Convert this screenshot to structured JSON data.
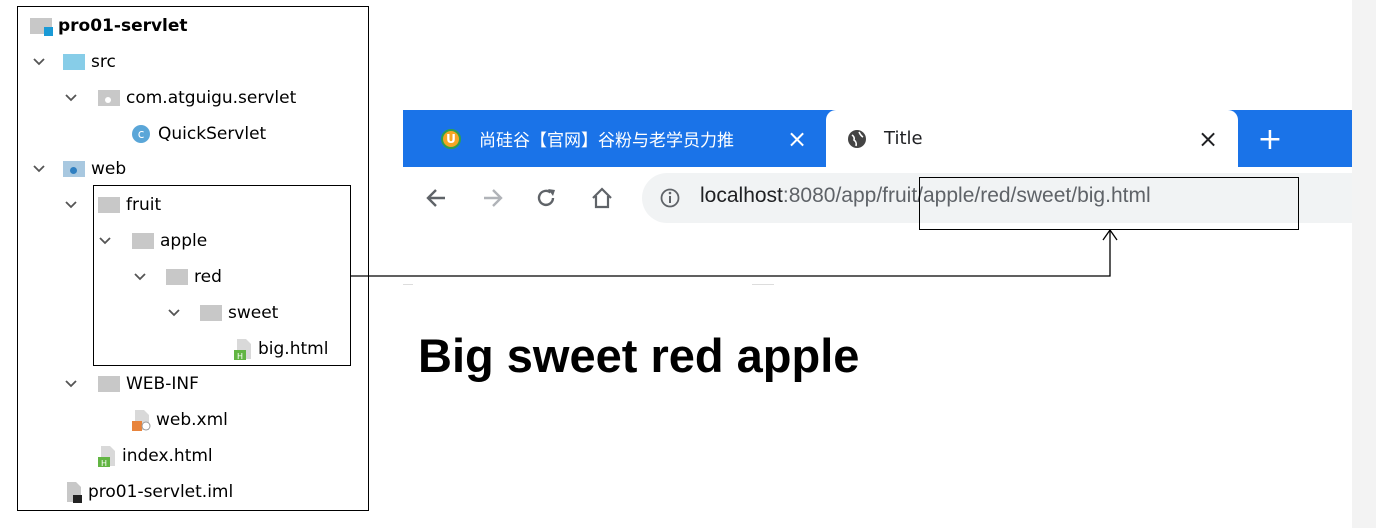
{
  "tree": {
    "root": "pro01-servlet",
    "src": "src",
    "package": "com.atguigu.servlet",
    "class_badge": "c",
    "class_name": "QuickServlet",
    "web": "web",
    "fruit": "fruit",
    "apple": "apple",
    "red": "red",
    "sweet": "sweet",
    "big_html": "big.html",
    "webinf": "WEB-INF",
    "webxml": "web.xml",
    "index_html": "index.html",
    "iml": "pro01-servlet.iml"
  },
  "browser": {
    "tab1_title": "尚硅谷【官网】谷粉与老学员力推",
    "tab1_favicon_letter": "U",
    "tab1_close": "×",
    "tab2_title": "Title",
    "tab2_close": "×",
    "new_tab": "+",
    "url_host": "localhost",
    "url_rest": ":8080/app/fruit/apple/red/sweet/big.html"
  },
  "page": {
    "heading": "Big sweet red apple"
  },
  "colors": {
    "tab_blue": "#1a73e8",
    "folder_blue": "#87cde8",
    "folder_gray": "#c8c8c8",
    "html_green": "#62b543",
    "xml_orange": "#e8843c"
  }
}
